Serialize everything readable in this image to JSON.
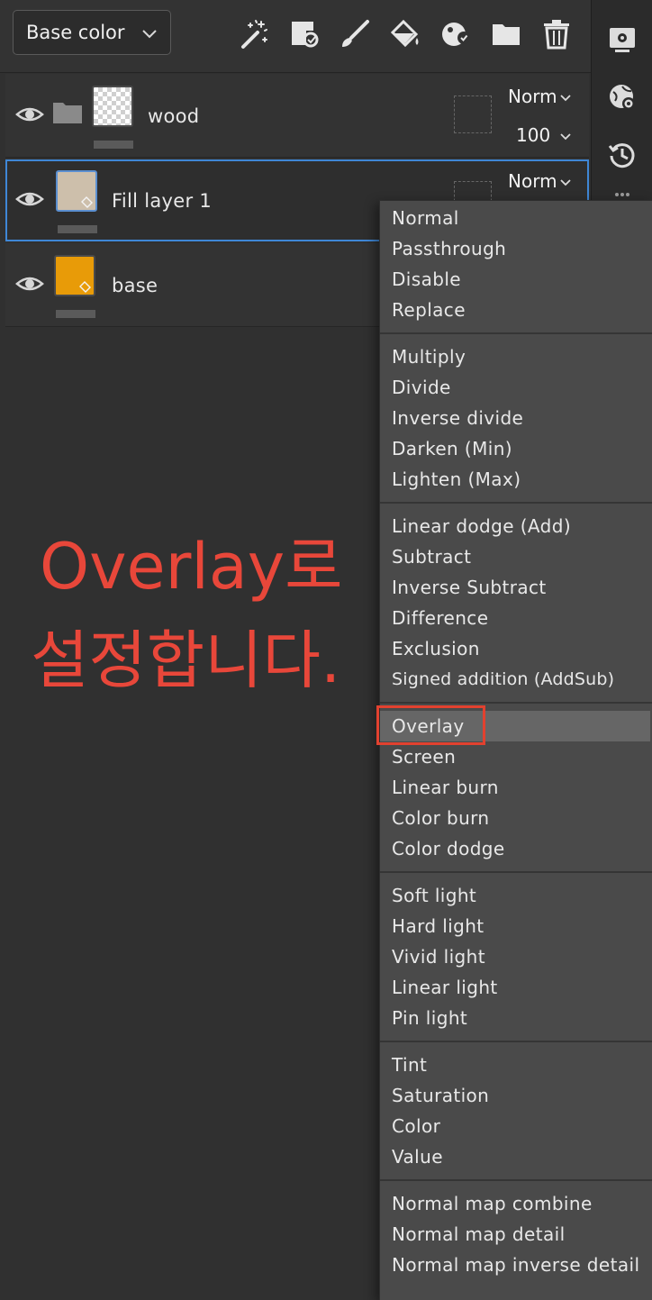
{
  "toolbar": {
    "channel_select": {
      "value": "Base color",
      "icon": "chevron-down-icon"
    },
    "tools": [
      {
        "name": "magic-wand-icon"
      },
      {
        "name": "smart-mask-icon"
      },
      {
        "name": "brush-icon"
      },
      {
        "name": "fill-bucket-icon"
      },
      {
        "name": "smart-material-icon"
      },
      {
        "name": "folder-icon"
      },
      {
        "name": "trash-icon"
      }
    ]
  },
  "dock": {
    "icons": [
      "settings-icon",
      "environment-settings-icon",
      "history-icon",
      "more-icon"
    ]
  },
  "layers": [
    {
      "name": "wood",
      "type": "folder",
      "blend_mode": "Norm",
      "opacity": "100",
      "thumb": "transparent"
    },
    {
      "name": "Fill layer 1",
      "type": "fill",
      "blend_mode": "Norm",
      "selected": true,
      "thumb_color": "#cdbfab"
    },
    {
      "name": "base",
      "type": "fill",
      "thumb_color": "#e89b08"
    }
  ],
  "blend_menu": {
    "groups": [
      [
        "Normal",
        "Passthrough",
        "Disable",
        "Replace"
      ],
      [
        "Multiply",
        "Divide",
        "Inverse divide",
        "Darken (Min)",
        "Lighten (Max)"
      ],
      [
        "Linear dodge (Add)",
        "Subtract",
        "Inverse Subtract",
        "Difference",
        "Exclusion",
        "Signed addition (AddSub)"
      ],
      [
        "Overlay",
        "Screen",
        "Linear burn",
        "Color burn",
        "Color dodge"
      ],
      [
        "Soft light",
        "Hard light",
        "Vivid light",
        "Linear light",
        "Pin light"
      ],
      [
        "Tint",
        "Saturation",
        "Color",
        "Value"
      ],
      [
        "Normal map combine",
        "Normal map detail",
        "Normal map inverse detail"
      ]
    ],
    "highlighted": "Overlay"
  },
  "annotation": {
    "line1": "Overlay로",
    "line2": "설정합니다."
  },
  "colors": {
    "accent_selection": "#3f87d6",
    "annotation_red": "#e8473a"
  }
}
